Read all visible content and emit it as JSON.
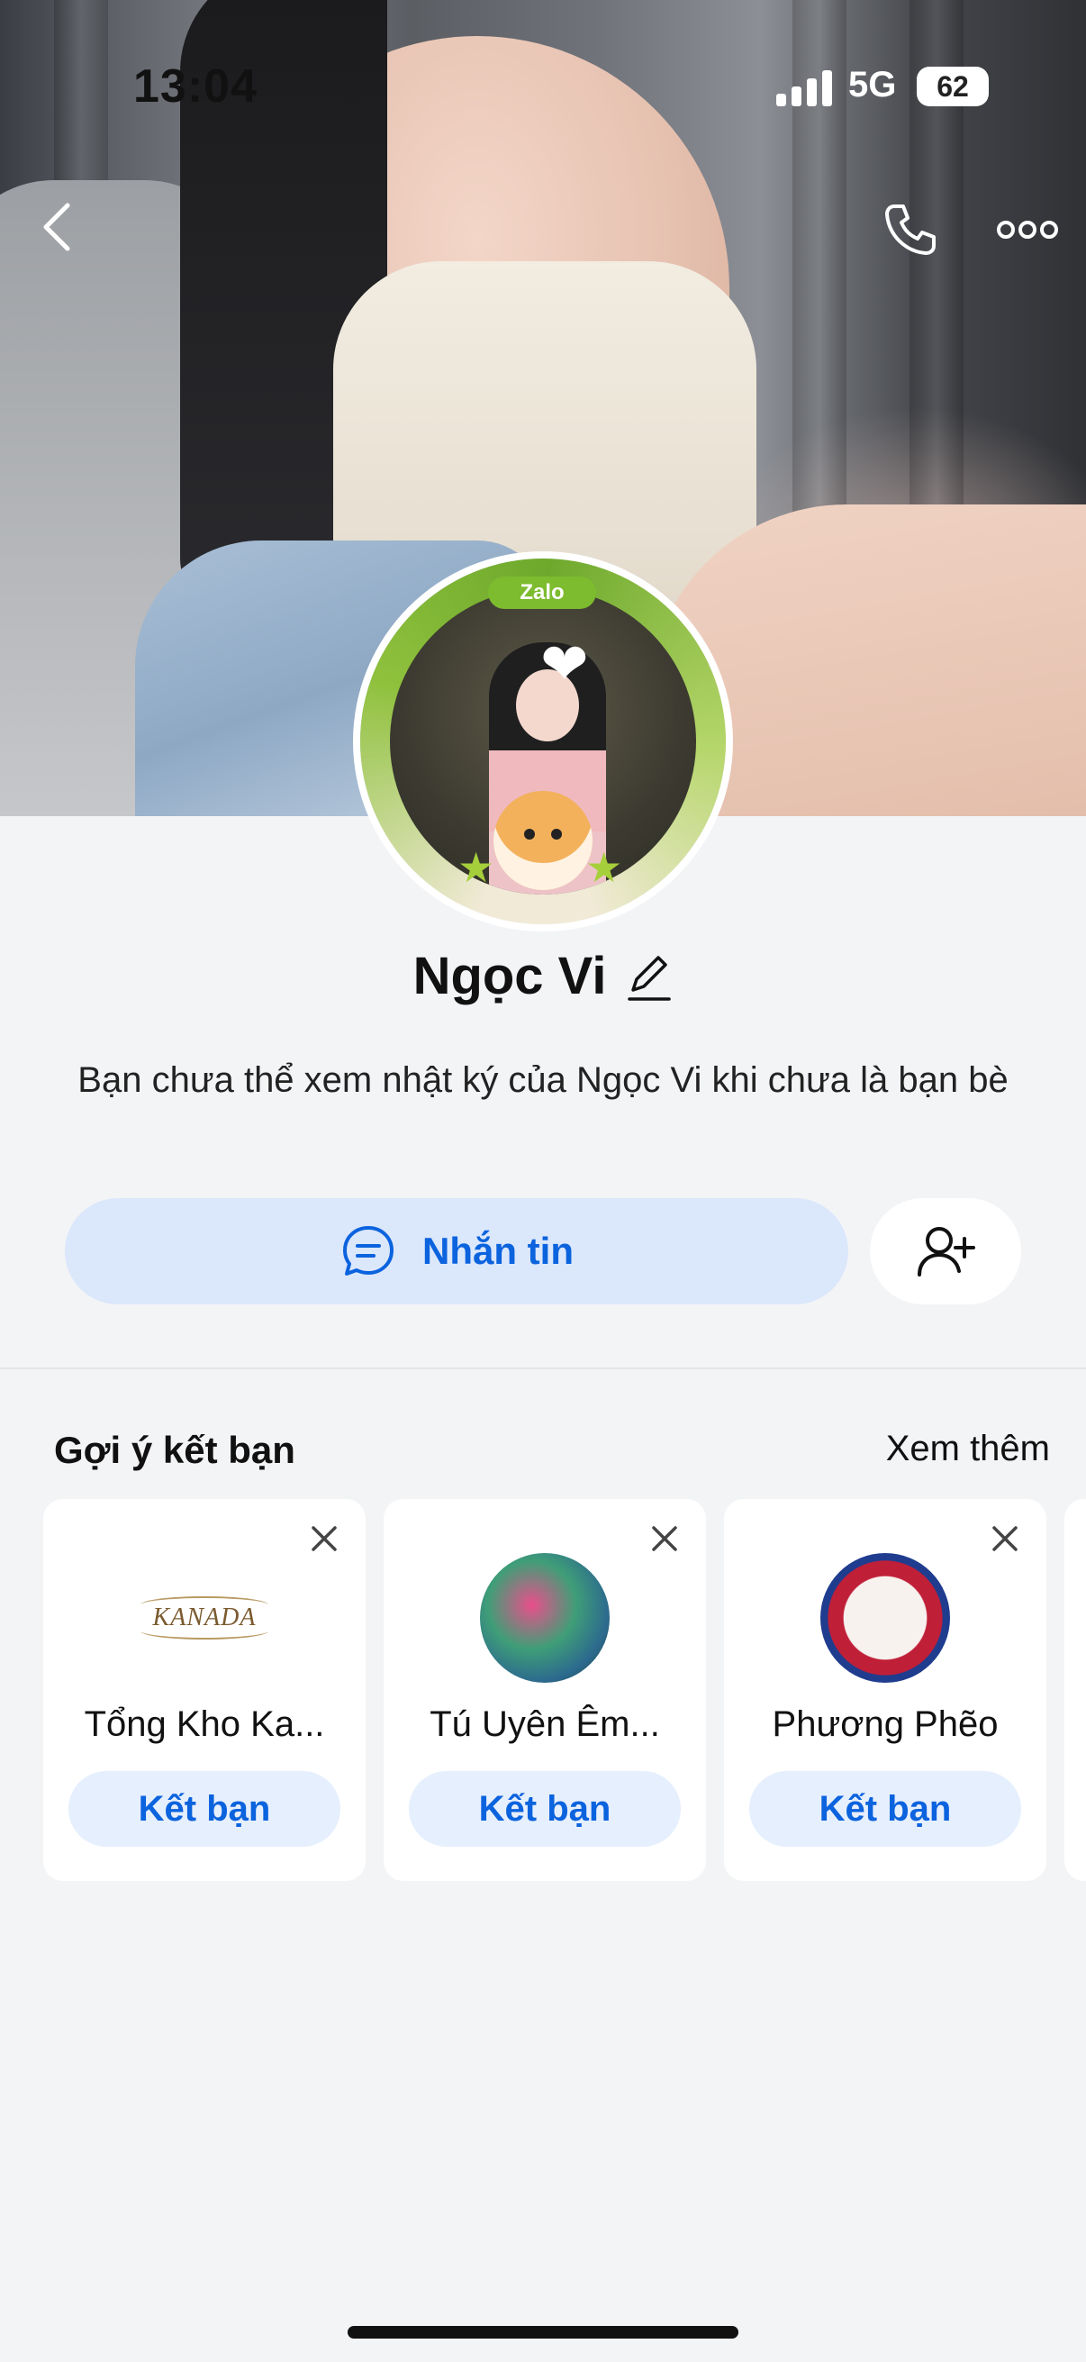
{
  "status_bar": {
    "time": "13:04",
    "network": "5G",
    "battery": "62"
  },
  "profile": {
    "name": "Ngọc Vi",
    "badge": "Zalo",
    "note": "Bạn chưa thể xem nhật ký của Ngọc Vi khi chưa là bạn bè"
  },
  "actions": {
    "message_label": "Nhắn tin"
  },
  "suggestions": {
    "title": "Gợi ý kết bạn",
    "see_more": "Xem thêm",
    "cards": [
      {
        "name": "Tổng Kho Ka...",
        "logo_text": "KANADA",
        "button": "Kết bạn"
      },
      {
        "name": "Tú Uyên Êm...",
        "button": "Kết bạn"
      },
      {
        "name": "Phương Phẽo",
        "button": "Kết bạn"
      }
    ]
  },
  "colors": {
    "accent": "#0b63de",
    "button_bg": "#dbe7fb",
    "page_bg": "#f3f4f6",
    "zalo_green": "#7dbb2f"
  },
  "icons": [
    "back-chevron-icon",
    "phone-icon",
    "more-dots-icon",
    "pencil-icon",
    "chat-bubble-icon",
    "add-friend-icon",
    "close-icon"
  ]
}
